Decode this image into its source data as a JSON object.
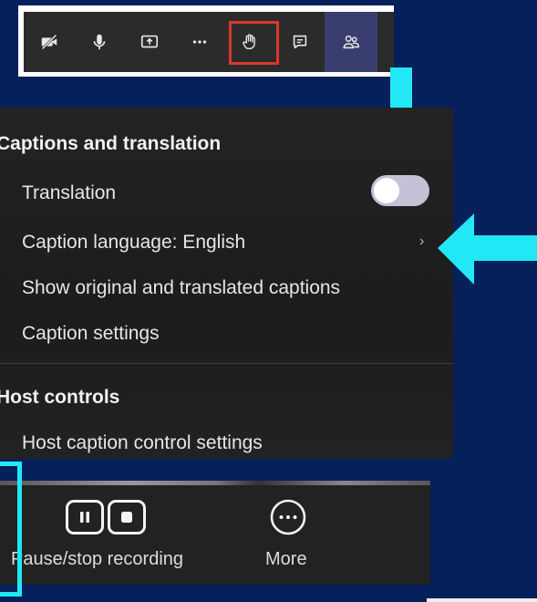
{
  "toolbar": {
    "buttons": [
      {
        "icon": "video-off-icon"
      },
      {
        "icon": "microphone-icon"
      },
      {
        "icon": "share-screen-icon"
      },
      {
        "icon": "more-dots-icon"
      },
      {
        "icon": "raise-hand-icon",
        "highlighted": true
      },
      {
        "icon": "chat-icon"
      },
      {
        "icon": "people-icon",
        "active": true
      }
    ],
    "highlight_color": "#d9372b"
  },
  "menu": {
    "captions_section_title": "Captions and translation",
    "translation_label": "Translation",
    "translation_enabled": false,
    "caption_language_label": "Caption language: English",
    "show_original_label": "Show original and translated captions",
    "caption_settings_label": "Caption settings",
    "host_section_title": "Host controls",
    "host_caption_label": "Host caption control settings"
  },
  "bottom_bar": {
    "pause_stop_label": "Pause/stop recording",
    "more_label": "More"
  },
  "annotations": {
    "arrow_color": "#22e7f5",
    "arrows": [
      "down-arrow-to-toggle",
      "left-arrow-to-chevron"
    ]
  },
  "colors": {
    "background": "#05205a",
    "menu_bg": "#1f1f1f",
    "toggle_off": "#c3c2d8"
  }
}
